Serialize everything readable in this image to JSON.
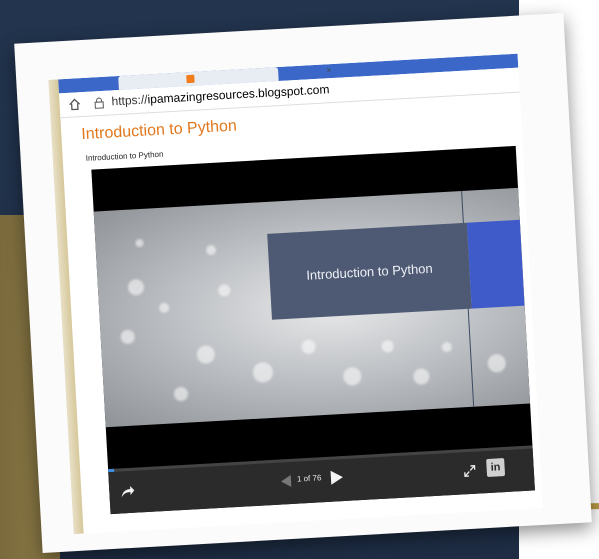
{
  "browser": {
    "url_prefix": "https://",
    "url_host": "ipamazingresources.blogspot.com"
  },
  "page": {
    "title": "Introduction to Python",
    "subtitle": "Introduction to Python"
  },
  "slide": {
    "title": "Introduction to Python"
  },
  "player": {
    "page_count": "1 of 76",
    "linkedin_label": "in",
    "progress_fraction": 0.013
  },
  "colors": {
    "page_title": "#e2781e",
    "slide_title_box": "#4e5a73",
    "slide_accent": "#3f5bc9",
    "tabstrip": "#3b67c9"
  },
  "icons": [
    "home-icon",
    "lock-icon",
    "share-icon",
    "prev-icon",
    "next-icon",
    "expand-icon",
    "linkedin-icon"
  ]
}
